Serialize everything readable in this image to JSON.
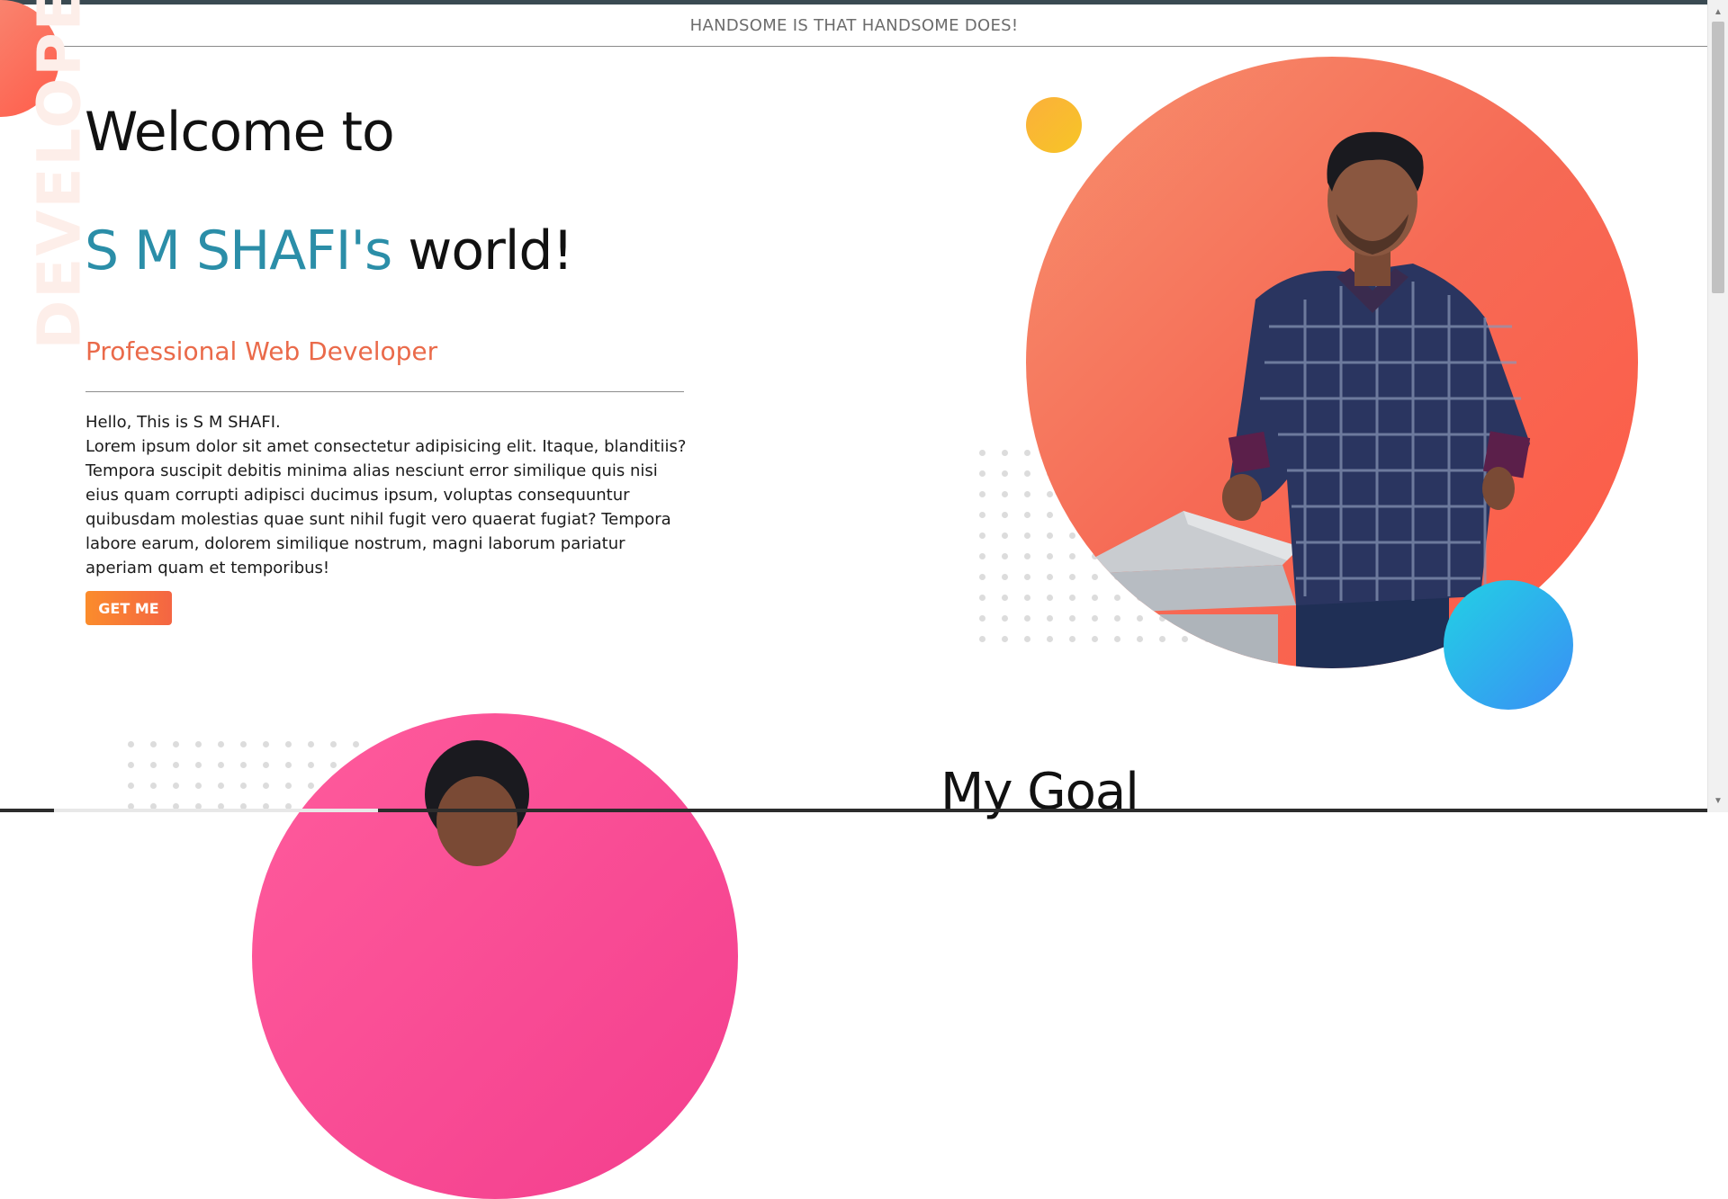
{
  "header": {
    "tagline": "HANDSOME IS THAT HANDSOME DOES!"
  },
  "hero": {
    "side_word": "DEVELOPER",
    "welcome_line": "Welcome to",
    "name": "S M SHAFI's",
    "world": "world!",
    "role": "Professional Web Developer",
    "greeting": "Hello, This is S M SHAFI.",
    "description": "Lorem ipsum dolor sit amet consectetur adipisicing elit. Itaque, blanditiis? Tempora suscipit debitis minima alias nesciunt error similique quis nisi eius quam corrupti adipisci ducimus ipsum, voluptas consequuntur quibusdam molestias quae sunt nihil fugit vero quaerat fugiat? Tempora labore earum, dolorem similique nostrum, magni laborum pariatur aperiam quam et temporibus!",
    "cta_label": "GET ME"
  },
  "goal": {
    "title": "My Goal"
  },
  "colors": {
    "accent_blue": "#2b8ea8",
    "accent_orange": "#ea6a4a",
    "hero_circle": "#f66a55",
    "pink_circle": "#f33e8e",
    "yellow_dot": "#fbb03b",
    "blue_dot": "#3a8ef5"
  },
  "icons": {
    "scroll_up": "triangle-up-icon",
    "scroll_down": "triangle-down-icon"
  }
}
